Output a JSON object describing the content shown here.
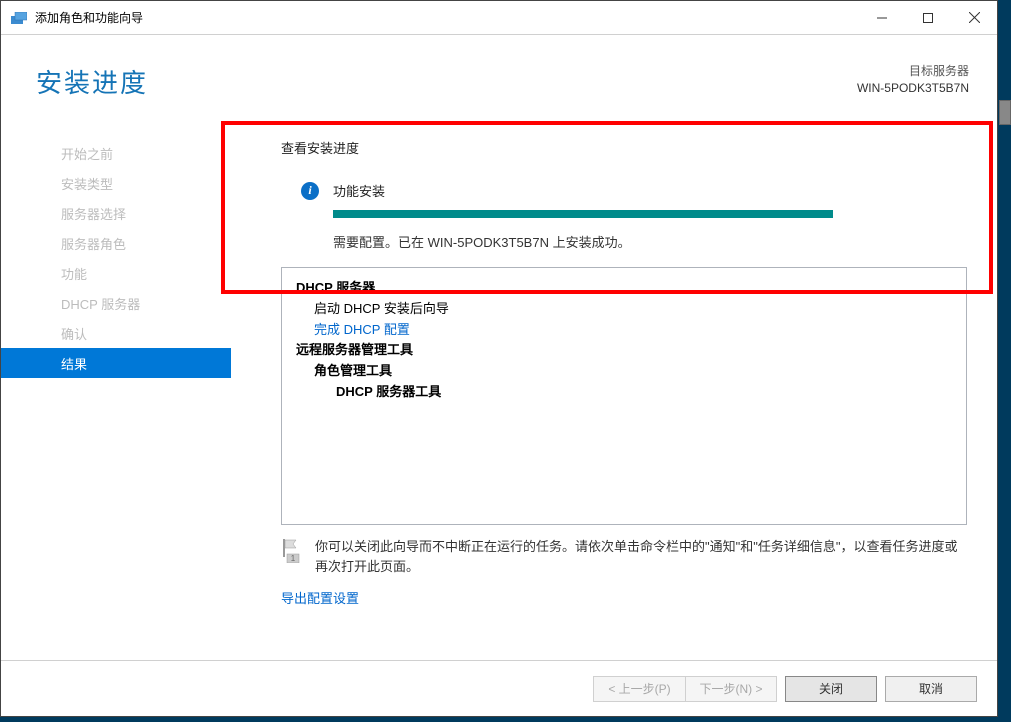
{
  "window_title": "添加角色和功能向导",
  "page_title": "安装进度",
  "destination": {
    "label": "目标服务器",
    "name": "WIN-5PODK3T5B7N"
  },
  "steps": [
    "开始之前",
    "安装类型",
    "服务器选择",
    "服务器角色",
    "功能",
    "DHCP 服务器",
    "确认",
    "结果"
  ],
  "active_step_index": 7,
  "section_label": "查看安装进度",
  "status_text": "功能安装",
  "progress_msg": "需要配置。已在 WIN-5PODK3T5B7N 上安装成功。",
  "results": {
    "dhcp_server": "DHCP 服务器",
    "launch_wizard": "启动 DHCP 安装后向导",
    "complete_config": "完成 DHCP 配置",
    "remote_tools": "远程服务器管理工具",
    "role_admin_tools": "角色管理工具",
    "dhcp_server_tools": "DHCP 服务器工具"
  },
  "footer_note": "你可以关闭此向导而不中断正在运行的任务。请依次单击命令栏中的\"通知\"和\"任务详细信息\"，以查看任务进度或再次打开此页面。",
  "export_link": "导出配置设置",
  "buttons": {
    "prev": "< 上一步(P)",
    "next": "下一步(N) >",
    "close": "关闭",
    "cancel": "取消"
  }
}
